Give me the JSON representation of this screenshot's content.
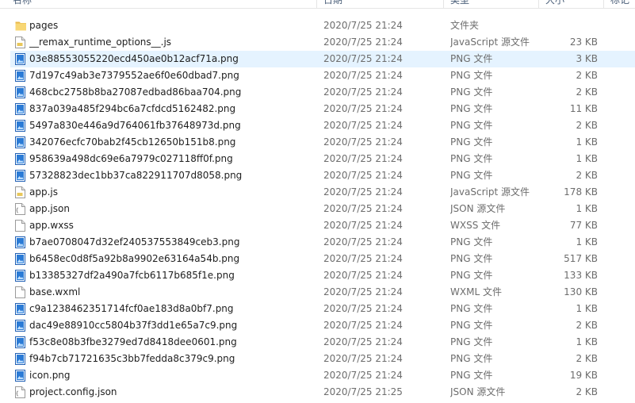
{
  "columns": {
    "name": "名称",
    "date": "日期",
    "type": "类型",
    "size": "大小",
    "tags": "标记"
  },
  "files": [
    {
      "name": "pages",
      "date": "2020/7/25 21:24",
      "type": "文件夹",
      "size": "",
      "icon": "folder-icon"
    },
    {
      "name": "__remax_runtime_options__.js",
      "date": "2020/7/25 21:24",
      "type": "JavaScript 源文件",
      "size": "23 KB",
      "icon": "js-file-icon"
    },
    {
      "name": "03e88553055220ecd450ae0b12acf71a.png",
      "date": "2020/7/25 21:24",
      "type": "PNG 文件",
      "size": "3 KB",
      "icon": "png-file-icon",
      "selected": true
    },
    {
      "name": "7d197c49ab3e7379552ae6f0e60dbad7.png",
      "date": "2020/7/25 21:24",
      "type": "PNG 文件",
      "size": "2 KB",
      "icon": "png-file-icon"
    },
    {
      "name": "468cbc2758b8ba27087edbad86baa704.png",
      "date": "2020/7/25 21:24",
      "type": "PNG 文件",
      "size": "2 KB",
      "icon": "png-file-icon"
    },
    {
      "name": "837a039a485f294bc6a7cfdcd5162482.png",
      "date": "2020/7/25 21:24",
      "type": "PNG 文件",
      "size": "11 KB",
      "icon": "png-file-icon"
    },
    {
      "name": "5497a830e446a9d764061fb37648973d.png",
      "date": "2020/7/25 21:24",
      "type": "PNG 文件",
      "size": "2 KB",
      "icon": "png-file-icon"
    },
    {
      "name": "342076ecfc70bab2f45cb12650b151b8.png",
      "date": "2020/7/25 21:24",
      "type": "PNG 文件",
      "size": "1 KB",
      "icon": "png-file-icon"
    },
    {
      "name": "958639a498dc69e6a7979c027118ff0f.png",
      "date": "2020/7/25 21:24",
      "type": "PNG 文件",
      "size": "1 KB",
      "icon": "png-file-icon"
    },
    {
      "name": "57328823dec1bb37ca822911707d8058.png",
      "date": "2020/7/25 21:24",
      "type": "PNG 文件",
      "size": "2 KB",
      "icon": "png-file-icon"
    },
    {
      "name": "app.js",
      "date": "2020/7/25 21:24",
      "type": "JavaScript 源文件",
      "size": "178 KB",
      "icon": "js-file-icon"
    },
    {
      "name": "app.json",
      "date": "2020/7/25 21:24",
      "type": "JSON 源文件",
      "size": "1 KB",
      "icon": "json-file-icon"
    },
    {
      "name": "app.wxss",
      "date": "2020/7/25 21:24",
      "type": "WXSS 文件",
      "size": "77 KB",
      "icon": "blank-file-icon"
    },
    {
      "name": "b7ae0708047d32ef240537553849ceb3.png",
      "date": "2020/7/25 21:24",
      "type": "PNG 文件",
      "size": "1 KB",
      "icon": "png-file-icon"
    },
    {
      "name": "b6458ec0d8f5a92b8a9902e63164a54b.png",
      "date": "2020/7/25 21:24",
      "type": "PNG 文件",
      "size": "517 KB",
      "icon": "png-file-icon"
    },
    {
      "name": "b13385327df2a490a7fcb6117b685f1e.png",
      "date": "2020/7/25 21:24",
      "type": "PNG 文件",
      "size": "133 KB",
      "icon": "png-file-icon"
    },
    {
      "name": "base.wxml",
      "date": "2020/7/25 21:24",
      "type": "WXML 文件",
      "size": "130 KB",
      "icon": "blank-file-icon"
    },
    {
      "name": "c9a1238462351714fcf0ae183d8a0bf7.png",
      "date": "2020/7/25 21:24",
      "type": "PNG 文件",
      "size": "1 KB",
      "icon": "png-file-icon"
    },
    {
      "name": "dac49e88910cc5804b37f3dd1e65a7c9.png",
      "date": "2020/7/25 21:24",
      "type": "PNG 文件",
      "size": "2 KB",
      "icon": "png-file-icon"
    },
    {
      "name": "f53c8e08b3fbe3279ed7d8418dee0601.png",
      "date": "2020/7/25 21:24",
      "type": "PNG 文件",
      "size": "1 KB",
      "icon": "png-file-icon"
    },
    {
      "name": "f94b7cb71721635c3bb7fedda8c379c9.png",
      "date": "2020/7/25 21:24",
      "type": "PNG 文件",
      "size": "2 KB",
      "icon": "png-file-icon"
    },
    {
      "name": "icon.png",
      "date": "2020/7/25 21:24",
      "type": "PNG 文件",
      "size": "19 KB",
      "icon": "png-file-icon"
    },
    {
      "name": "project.config.json",
      "date": "2020/7/25 21:25",
      "type": "JSON 源文件",
      "size": "2 KB",
      "icon": "json-file-icon"
    }
  ],
  "colors": {
    "selection": "#e5f3ff",
    "folder": "#f8d775",
    "png_icon": "#1f6fd1",
    "secondary_text": "#6d6d6d"
  }
}
